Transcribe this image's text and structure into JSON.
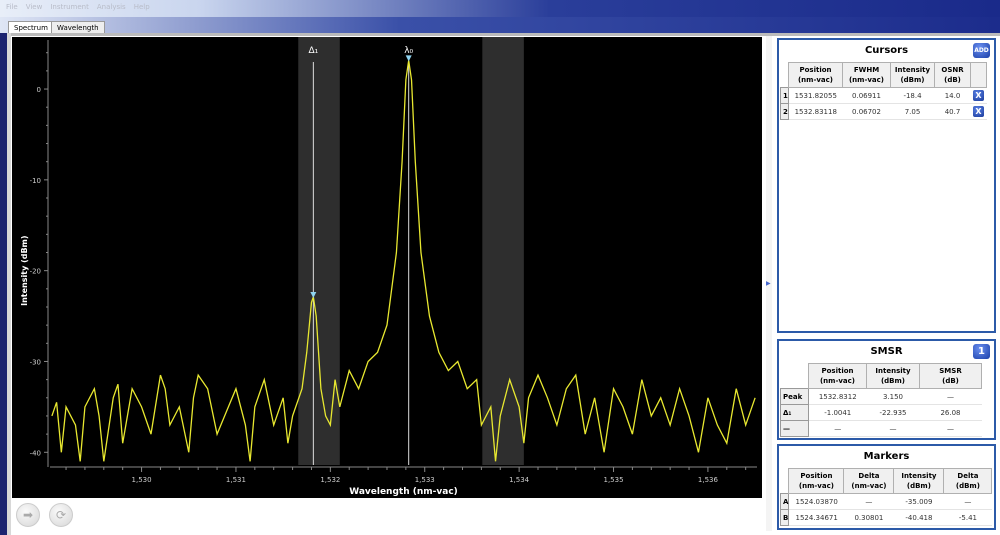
{
  "window": {
    "menu": [
      "File",
      "View",
      "Instrument",
      "Analysis",
      "Help"
    ],
    "tabs": [
      "Spectrum",
      "Wavelength"
    ],
    "active_tab": "Spectrum"
  },
  "chart_data": {
    "type": "line",
    "xlabel": "Wavelength (nm-vac)",
    "ylabel": "Intensity (dBm)",
    "xlim": [
      1529.03,
      1536.52
    ],
    "ylim": [
      -41.4,
      5.4
    ],
    "xticks": [
      1530,
      1531,
      1532,
      1533,
      1534,
      1535,
      1536
    ],
    "xtick_labels": [
      "1,530",
      "1,531",
      "1,532",
      "1,533",
      "1,534",
      "1,535",
      "1,536"
    ],
    "yticks": [
      0,
      -10,
      -20,
      -30,
      -40
    ],
    "ytick_labels": [
      "0",
      "-10",
      "-20",
      "-30",
      "-40"
    ],
    "grid": false,
    "background": "#000000",
    "line_color": "#e8e830",
    "cursor_labels": [
      "Δ₁",
      "λ₀"
    ],
    "cursors": [
      1531.82,
      1532.83
    ],
    "bands": [
      [
        1531.66,
        1532.1
      ],
      [
        1533.61,
        1534.05
      ]
    ],
    "series": [
      {
        "points": [
          [
            1529.05,
            -36
          ],
          [
            1529.1,
            -34.5
          ],
          [
            1529.15,
            -40
          ],
          [
            1529.2,
            -35
          ],
          [
            1529.3,
            -37
          ],
          [
            1529.35,
            -41
          ],
          [
            1529.4,
            -35
          ],
          [
            1529.5,
            -33
          ],
          [
            1529.55,
            -36
          ],
          [
            1529.6,
            -41
          ],
          [
            1529.7,
            -34
          ],
          [
            1529.75,
            -32.5
          ],
          [
            1529.8,
            -39
          ],
          [
            1529.9,
            -33
          ],
          [
            1530.0,
            -35
          ],
          [
            1530.1,
            -38
          ],
          [
            1530.2,
            -31.5
          ],
          [
            1530.25,
            -33
          ],
          [
            1530.3,
            -37
          ],
          [
            1530.4,
            -35
          ],
          [
            1530.5,
            -40
          ],
          [
            1530.55,
            -34
          ],
          [
            1530.6,
            -31.5
          ],
          [
            1530.7,
            -33
          ],
          [
            1530.8,
            -38
          ],
          [
            1530.9,
            -35.5
          ],
          [
            1531.0,
            -33
          ],
          [
            1531.1,
            -37
          ],
          [
            1531.15,
            -41
          ],
          [
            1531.2,
            -35
          ],
          [
            1531.3,
            -32
          ],
          [
            1531.4,
            -37
          ],
          [
            1531.5,
            -34
          ],
          [
            1531.55,
            -39
          ],
          [
            1531.6,
            -36
          ],
          [
            1531.7,
            -33
          ],
          [
            1531.75,
            -29
          ],
          [
            1531.8,
            -23.5
          ],
          [
            1531.82,
            -22.9
          ],
          [
            1531.85,
            -25
          ],
          [
            1531.9,
            -33
          ],
          [
            1531.95,
            -36
          ],
          [
            1532.0,
            -37
          ],
          [
            1532.05,
            -32
          ],
          [
            1532.1,
            -35
          ],
          [
            1532.2,
            -31
          ],
          [
            1532.3,
            -33
          ],
          [
            1532.4,
            -30
          ],
          [
            1532.5,
            -29
          ],
          [
            1532.6,
            -26
          ],
          [
            1532.7,
            -18
          ],
          [
            1532.76,
            -8
          ],
          [
            1532.8,
            1
          ],
          [
            1532.83,
            3.15
          ],
          [
            1532.86,
            1
          ],
          [
            1532.9,
            -8
          ],
          [
            1532.96,
            -18
          ],
          [
            1533.05,
            -25
          ],
          [
            1533.15,
            -29
          ],
          [
            1533.25,
            -31
          ],
          [
            1533.35,
            -30
          ],
          [
            1533.45,
            -33
          ],
          [
            1533.55,
            -32
          ],
          [
            1533.6,
            -37
          ],
          [
            1533.7,
            -35
          ],
          [
            1533.75,
            -41
          ],
          [
            1533.8,
            -36
          ],
          [
            1533.9,
            -32
          ],
          [
            1534.0,
            -35
          ],
          [
            1534.05,
            -39
          ],
          [
            1534.1,
            -34
          ],
          [
            1534.2,
            -31.5
          ],
          [
            1534.3,
            -34
          ],
          [
            1534.4,
            -37
          ],
          [
            1534.5,
            -33
          ],
          [
            1534.6,
            -31.5
          ],
          [
            1534.7,
            -38
          ],
          [
            1534.8,
            -34
          ],
          [
            1534.9,
            -40
          ],
          [
            1535.0,
            -33
          ],
          [
            1535.1,
            -35
          ],
          [
            1535.2,
            -38
          ],
          [
            1535.3,
            -32
          ],
          [
            1535.4,
            -36
          ],
          [
            1535.5,
            -34
          ],
          [
            1535.6,
            -37
          ],
          [
            1535.7,
            -33
          ],
          [
            1535.8,
            -36
          ],
          [
            1535.9,
            -40
          ],
          [
            1536.0,
            -34
          ],
          [
            1536.1,
            -37
          ],
          [
            1536.2,
            -39
          ],
          [
            1536.3,
            -33
          ],
          [
            1536.4,
            -37
          ],
          [
            1536.5,
            -34
          ]
        ]
      }
    ]
  },
  "cursors": {
    "title": "Cursors",
    "add_label": "ADD",
    "headers": [
      [
        "Position",
        "(nm-vac)"
      ],
      [
        "FWHM",
        "(nm-vac)"
      ],
      [
        "Intensity",
        "(dBm)"
      ],
      [
        "OSNR",
        "(dB)"
      ]
    ],
    "rows": [
      {
        "id": "1",
        "cells": [
          "1531.82055",
          "0.06911",
          "-18.4",
          "14.0"
        ],
        "delete": "X"
      },
      {
        "id": "2",
        "cells": [
          "1532.83118",
          "0.06702",
          "7.05",
          "40.7"
        ],
        "delete": "X"
      }
    ]
  },
  "smsr": {
    "title": "SMSR",
    "badge": "1",
    "headers": [
      [
        "Position",
        "(nm-vac)"
      ],
      [
        "Intensity",
        "(dBm)"
      ],
      [
        "SMSR",
        "(dB)"
      ]
    ],
    "rows": [
      {
        "id": "Peak",
        "cells": [
          "1532.8312",
          "3.150",
          "—"
        ]
      },
      {
        "id": "Δ₁",
        "cells": [
          "-1.0041",
          "-22.935",
          "26.08"
        ]
      },
      {
        "id": "—",
        "cells": [
          "—",
          "—",
          "—"
        ]
      }
    ]
  },
  "markers": {
    "title": "Markers",
    "headers": [
      [
        "Position",
        "(nm-vac)"
      ],
      [
        "Delta",
        "(nm-vac)"
      ],
      [
        "Intensity",
        "(dBm)"
      ],
      [
        "Delta",
        "(dBm)"
      ]
    ],
    "rows": [
      {
        "id": "A",
        "cells": [
          "1524.03870",
          "—",
          "-35.009",
          "—"
        ]
      },
      {
        "id": "B",
        "cells": [
          "1524.34671",
          "0.30801",
          "-40.418",
          "-5.41"
        ]
      }
    ]
  },
  "controls": {
    "play_icon": "arrow-right-icon",
    "refresh_icon": "refresh-icon"
  }
}
